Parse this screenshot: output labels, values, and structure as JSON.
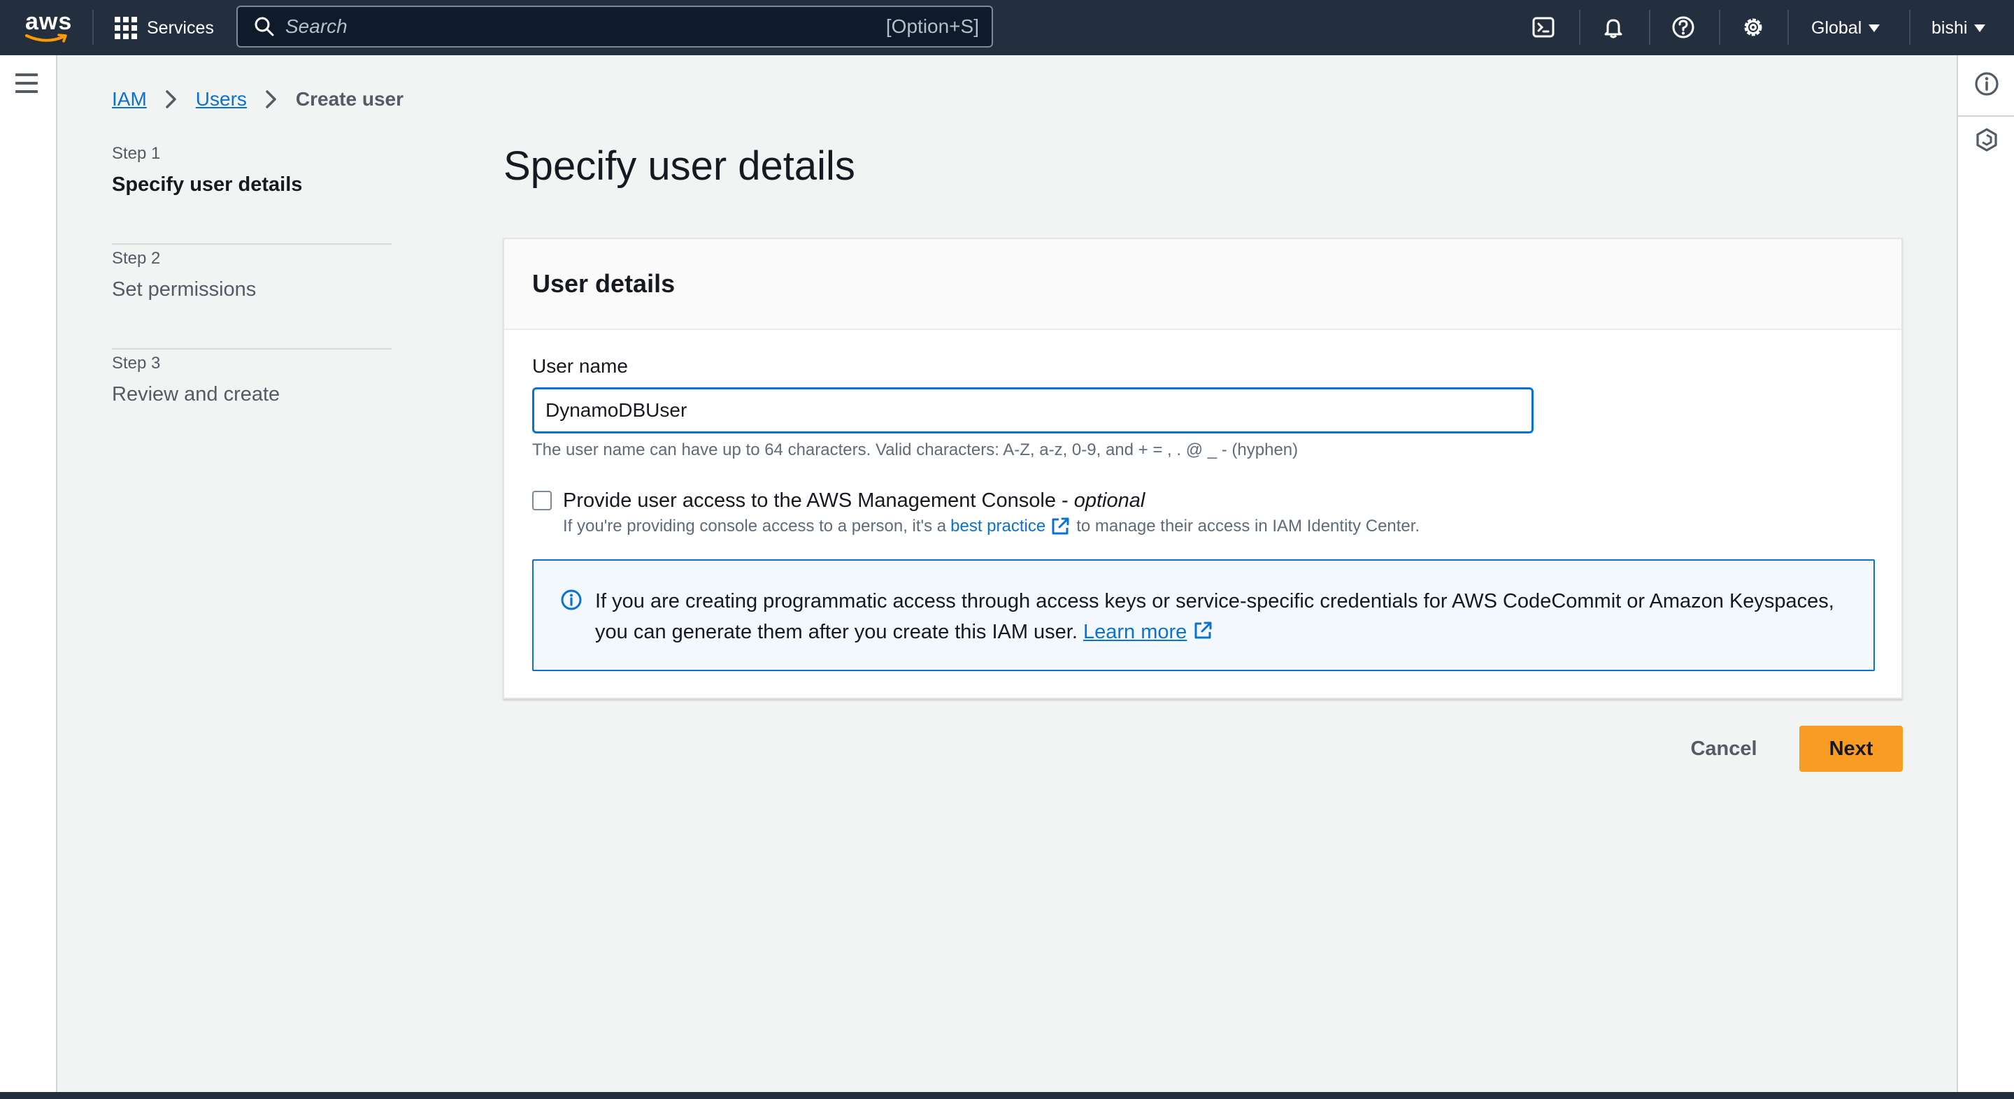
{
  "topnav": {
    "logo_text": "aws",
    "services_label": "Services",
    "search_placeholder": "Search",
    "search_shortcut": "[Option+S]",
    "region_label": "Global",
    "user_label": "bishi",
    "icons": [
      "cloudshell-icon",
      "bell-icon",
      "help-icon",
      "settings-icon"
    ]
  },
  "breadcrumb": {
    "items": [
      "IAM",
      "Users"
    ],
    "current": "Create user"
  },
  "steps": [
    {
      "number": "Step 1",
      "name": "Specify user details",
      "active": true
    },
    {
      "number": "Step 2",
      "name": "Set permissions",
      "active": false
    },
    {
      "number": "Step 3",
      "name": "Review and create",
      "active": false
    }
  ],
  "main": {
    "title": "Specify user details",
    "panel_title": "User details",
    "username_label": "User name",
    "username_value": "DynamoDBUser",
    "username_constraint": "The user name can have up to 64 characters. Valid characters: A-Z, a-z, 0-9, and + = , . @ _ - (hyphen)",
    "console_access_label": "Provide user access to the AWS Management Console - ",
    "console_access_optional": "optional",
    "console_access_checked": false,
    "console_desc_before": "If you're providing console access to a person, it's a",
    "console_desc_link": "best practice",
    "console_desc_after": "to manage their access in IAM Identity Center.",
    "info_text": "If you are creating programmatic access through access keys or service-specific credentials for AWS CodeCommit or Amazon Keyspaces, you can generate them after you create this IAM user.",
    "info_link": "Learn more"
  },
  "actions": {
    "cancel_label": "Cancel",
    "next_label": "Next"
  },
  "colors": {
    "nav_bg": "#232f3e",
    "accent_link": "#0972d3",
    "primary_button": "#f89c24",
    "page_bg": "#f2f3f3"
  }
}
